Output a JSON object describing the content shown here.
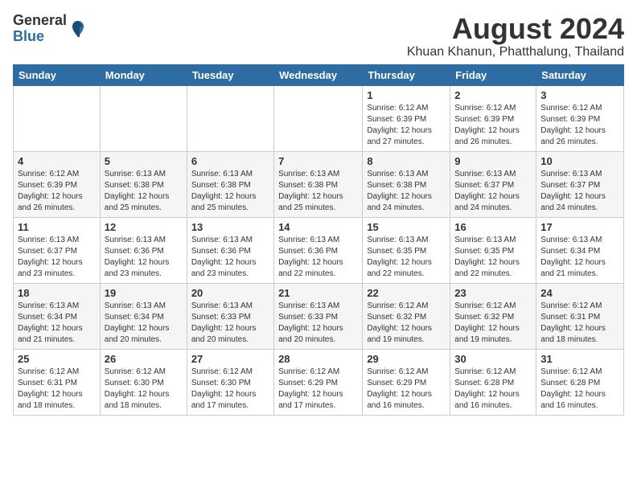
{
  "header": {
    "logo_general": "General",
    "logo_blue": "Blue",
    "month_title": "August 2024",
    "location": "Khuan Khanun, Phatthalung, Thailand"
  },
  "weekdays": [
    "Sunday",
    "Monday",
    "Tuesday",
    "Wednesday",
    "Thursday",
    "Friday",
    "Saturday"
  ],
  "weeks": [
    [
      {
        "day": "",
        "info": ""
      },
      {
        "day": "",
        "info": ""
      },
      {
        "day": "",
        "info": ""
      },
      {
        "day": "",
        "info": ""
      },
      {
        "day": "1",
        "info": "Sunrise: 6:12 AM\nSunset: 6:39 PM\nDaylight: 12 hours\nand 27 minutes."
      },
      {
        "day": "2",
        "info": "Sunrise: 6:12 AM\nSunset: 6:39 PM\nDaylight: 12 hours\nand 26 minutes."
      },
      {
        "day": "3",
        "info": "Sunrise: 6:12 AM\nSunset: 6:39 PM\nDaylight: 12 hours\nand 26 minutes."
      }
    ],
    [
      {
        "day": "4",
        "info": "Sunrise: 6:12 AM\nSunset: 6:39 PM\nDaylight: 12 hours\nand 26 minutes."
      },
      {
        "day": "5",
        "info": "Sunrise: 6:13 AM\nSunset: 6:38 PM\nDaylight: 12 hours\nand 25 minutes."
      },
      {
        "day": "6",
        "info": "Sunrise: 6:13 AM\nSunset: 6:38 PM\nDaylight: 12 hours\nand 25 minutes."
      },
      {
        "day": "7",
        "info": "Sunrise: 6:13 AM\nSunset: 6:38 PM\nDaylight: 12 hours\nand 25 minutes."
      },
      {
        "day": "8",
        "info": "Sunrise: 6:13 AM\nSunset: 6:38 PM\nDaylight: 12 hours\nand 24 minutes."
      },
      {
        "day": "9",
        "info": "Sunrise: 6:13 AM\nSunset: 6:37 PM\nDaylight: 12 hours\nand 24 minutes."
      },
      {
        "day": "10",
        "info": "Sunrise: 6:13 AM\nSunset: 6:37 PM\nDaylight: 12 hours\nand 24 minutes."
      }
    ],
    [
      {
        "day": "11",
        "info": "Sunrise: 6:13 AM\nSunset: 6:37 PM\nDaylight: 12 hours\nand 23 minutes."
      },
      {
        "day": "12",
        "info": "Sunrise: 6:13 AM\nSunset: 6:36 PM\nDaylight: 12 hours\nand 23 minutes."
      },
      {
        "day": "13",
        "info": "Sunrise: 6:13 AM\nSunset: 6:36 PM\nDaylight: 12 hours\nand 23 minutes."
      },
      {
        "day": "14",
        "info": "Sunrise: 6:13 AM\nSunset: 6:36 PM\nDaylight: 12 hours\nand 22 minutes."
      },
      {
        "day": "15",
        "info": "Sunrise: 6:13 AM\nSunset: 6:35 PM\nDaylight: 12 hours\nand 22 minutes."
      },
      {
        "day": "16",
        "info": "Sunrise: 6:13 AM\nSunset: 6:35 PM\nDaylight: 12 hours\nand 22 minutes."
      },
      {
        "day": "17",
        "info": "Sunrise: 6:13 AM\nSunset: 6:34 PM\nDaylight: 12 hours\nand 21 minutes."
      }
    ],
    [
      {
        "day": "18",
        "info": "Sunrise: 6:13 AM\nSunset: 6:34 PM\nDaylight: 12 hours\nand 21 minutes."
      },
      {
        "day": "19",
        "info": "Sunrise: 6:13 AM\nSunset: 6:34 PM\nDaylight: 12 hours\nand 20 minutes."
      },
      {
        "day": "20",
        "info": "Sunrise: 6:13 AM\nSunset: 6:33 PM\nDaylight: 12 hours\nand 20 minutes."
      },
      {
        "day": "21",
        "info": "Sunrise: 6:13 AM\nSunset: 6:33 PM\nDaylight: 12 hours\nand 20 minutes."
      },
      {
        "day": "22",
        "info": "Sunrise: 6:12 AM\nSunset: 6:32 PM\nDaylight: 12 hours\nand 19 minutes."
      },
      {
        "day": "23",
        "info": "Sunrise: 6:12 AM\nSunset: 6:32 PM\nDaylight: 12 hours\nand 19 minutes."
      },
      {
        "day": "24",
        "info": "Sunrise: 6:12 AM\nSunset: 6:31 PM\nDaylight: 12 hours\nand 18 minutes."
      }
    ],
    [
      {
        "day": "25",
        "info": "Sunrise: 6:12 AM\nSunset: 6:31 PM\nDaylight: 12 hours\nand 18 minutes."
      },
      {
        "day": "26",
        "info": "Sunrise: 6:12 AM\nSunset: 6:30 PM\nDaylight: 12 hours\nand 18 minutes."
      },
      {
        "day": "27",
        "info": "Sunrise: 6:12 AM\nSunset: 6:30 PM\nDaylight: 12 hours\nand 17 minutes."
      },
      {
        "day": "28",
        "info": "Sunrise: 6:12 AM\nSunset: 6:29 PM\nDaylight: 12 hours\nand 17 minutes."
      },
      {
        "day": "29",
        "info": "Sunrise: 6:12 AM\nSunset: 6:29 PM\nDaylight: 12 hours\nand 16 minutes."
      },
      {
        "day": "30",
        "info": "Sunrise: 6:12 AM\nSunset: 6:28 PM\nDaylight: 12 hours\nand 16 minutes."
      },
      {
        "day": "31",
        "info": "Sunrise: 6:12 AM\nSunset: 6:28 PM\nDaylight: 12 hours\nand 16 minutes."
      }
    ]
  ]
}
